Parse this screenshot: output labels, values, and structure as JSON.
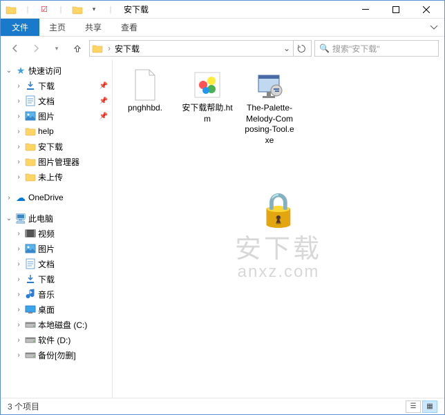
{
  "titlebar": {
    "title": "安下载"
  },
  "ribbon": {
    "file": "文件",
    "home": "主页",
    "share": "共享",
    "view": "查看"
  },
  "address": {
    "current": "安下载"
  },
  "search": {
    "placeholder": "搜索\"安下载\""
  },
  "sidebar": {
    "quickaccess": "快速访问",
    "items": [
      {
        "label": "下载",
        "icon": "download",
        "pinned": true
      },
      {
        "label": "文档",
        "icon": "document",
        "pinned": true
      },
      {
        "label": "图片",
        "icon": "pictures",
        "pinned": true
      },
      {
        "label": "help",
        "icon": "folder",
        "pinned": false
      },
      {
        "label": "安下载",
        "icon": "folder",
        "pinned": false
      },
      {
        "label": "图片管理器",
        "icon": "folder",
        "pinned": false
      },
      {
        "label": "未上传",
        "icon": "folder",
        "pinned": false
      }
    ],
    "onedrive": "OneDrive",
    "thispc": "此电脑",
    "pcitems": [
      {
        "label": "视频",
        "icon": "video"
      },
      {
        "label": "图片",
        "icon": "pictures"
      },
      {
        "label": "文档",
        "icon": "document"
      },
      {
        "label": "下载",
        "icon": "download"
      },
      {
        "label": "音乐",
        "icon": "music"
      },
      {
        "label": "桌面",
        "icon": "desktop"
      },
      {
        "label": "本地磁盘 (C:)",
        "icon": "drive"
      },
      {
        "label": "软件 (D:)",
        "icon": "drive"
      },
      {
        "label": "备份[勿删]",
        "icon": "drive"
      }
    ]
  },
  "files": [
    {
      "name": "pnghhbd.",
      "type": "blank"
    },
    {
      "name": "安下载帮助.htm",
      "type": "htm"
    },
    {
      "name": "The-Palette-Melody-Composing-Tool.exe",
      "type": "exe"
    }
  ],
  "watermark": {
    "text": "安下载",
    "sub": "anxz.com"
  },
  "status": {
    "text": "3 个项目"
  }
}
